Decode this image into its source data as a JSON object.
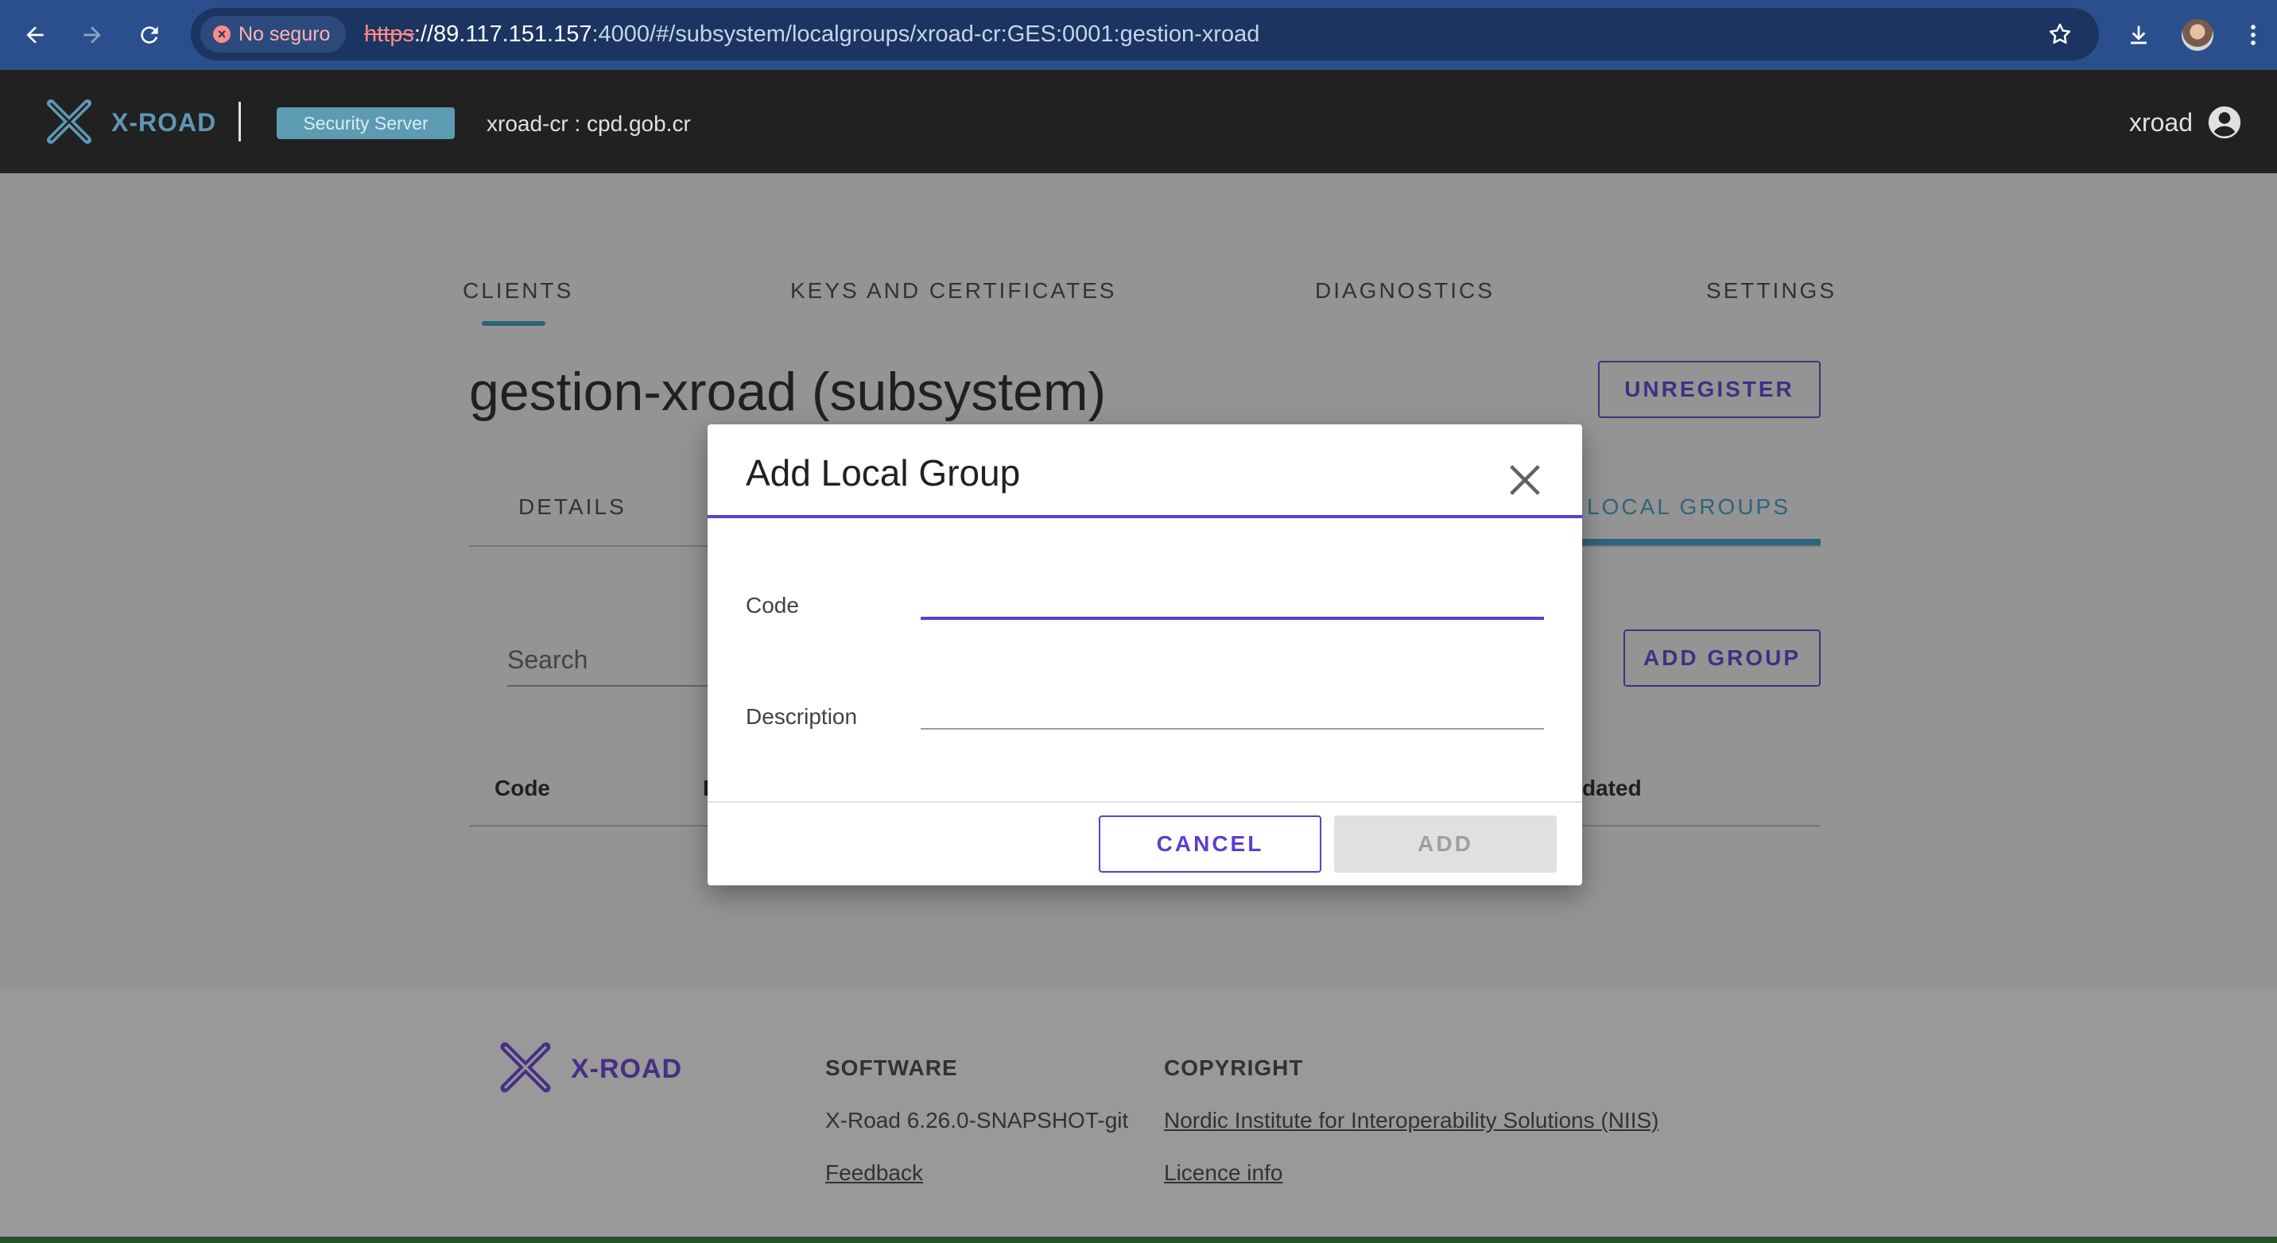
{
  "browser": {
    "security_label": "No seguro",
    "url_scheme": "https",
    "url_host": "://89.117.151.157",
    "url_rest": ":4000/#/subsystem/localgroups/xroad-cr:GES:0001:gestion-xroad"
  },
  "header": {
    "logo_text": "X-ROAD",
    "badge": "Security Server",
    "instance": "xroad-cr : cpd.gob.cr",
    "user": "xroad"
  },
  "main_tabs": [
    "CLIENTS",
    "KEYS AND CERTIFICATES",
    "DIAGNOSTICS",
    "SETTINGS"
  ],
  "page": {
    "title": "gestion-xroad (subsystem)",
    "unregister_label": "UNREGISTER",
    "sub_tabs": [
      "DETAILS",
      "LOCAL GROUPS"
    ],
    "search_placeholder": "Search",
    "add_group_label": "ADD GROUP",
    "columns": [
      "Code",
      "D",
      "dated"
    ]
  },
  "dialog": {
    "title": "Add Local Group",
    "code_label": "Code",
    "code_value": "",
    "description_label": "Description",
    "description_value": "",
    "cancel_label": "CANCEL",
    "add_label": "ADD"
  },
  "footer": {
    "logo_text": "X-ROAD",
    "software_heading": "SOFTWARE",
    "version": "X-Road 6.26.0-SNAPSHOT-git",
    "feedback": "Feedback",
    "copyright_heading": "COPYRIGHT",
    "niis": "Nordic Institute for Interoperability Solutions (NIIS)",
    "licence": "Licence info"
  },
  "colors": {
    "accent": "#5a3fd1",
    "tab_indicator": "#3a9ec9",
    "header_bg": "#212121",
    "browser_bg": "#2b4f8c"
  }
}
